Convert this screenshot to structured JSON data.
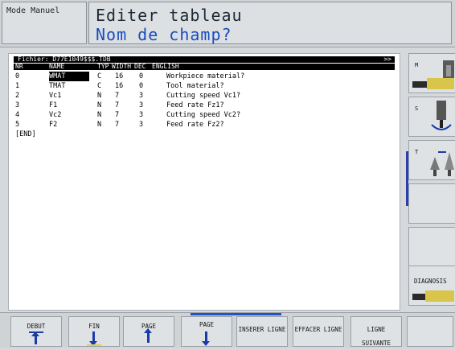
{
  "header": {
    "mode": "Mode Manuel",
    "title": "Editer tableau",
    "prompt": "Nom de champ?"
  },
  "file_bar": {
    "label": "Fichier: D77E1049$$$.TDB",
    "more": ">>"
  },
  "columns": [
    "NR",
    "NAME",
    "TYP",
    "WIDTH",
    "DEC",
    "ENGLISH"
  ],
  "rows": [
    {
      "nr": "0",
      "name": "WMAT",
      "typ": "C",
      "width": "16",
      "dec": "0",
      "english": "Workpiece material?"
    },
    {
      "nr": "1",
      "name": "TMAT",
      "typ": "C",
      "width": "16",
      "dec": "0",
      "english": "Tool material?"
    },
    {
      "nr": "2",
      "name": "Vc1",
      "typ": "N",
      "width": "7",
      "dec": "3",
      "english": "Cutting speed Vc1?"
    },
    {
      "nr": "3",
      "name": "F1",
      "typ": "N",
      "width": "7",
      "dec": "3",
      "english": "Feed rate Fz1?"
    },
    {
      "nr": "4",
      "name": "Vc2",
      "typ": "N",
      "width": "7",
      "dec": "3",
      "english": "Cutting speed Vc2?"
    },
    {
      "nr": "5",
      "name": "F2",
      "typ": "N",
      "width": "7",
      "dec": "3",
      "english": "Feed rate Fz2?"
    }
  ],
  "end_marker": "[END]",
  "side_keys": {
    "m": "M",
    "s": "S",
    "t": "T",
    "diagnosis": "DIAGNOSIS"
  },
  "soft_keys": [
    {
      "label": "DEBUT"
    },
    {
      "label": "FIN"
    },
    {
      "label": "PAGE"
    },
    {
      "label": "PAGE"
    },
    {
      "label": "INSERER LIGNE"
    },
    {
      "label": "EFFACER LIGNE"
    },
    {
      "label": "LIGNE SUIVANTE"
    }
  ],
  "colors": {
    "accent": "#1f55c8",
    "title_blue": "#1a4bbd",
    "highlight": "#e3d14a"
  }
}
